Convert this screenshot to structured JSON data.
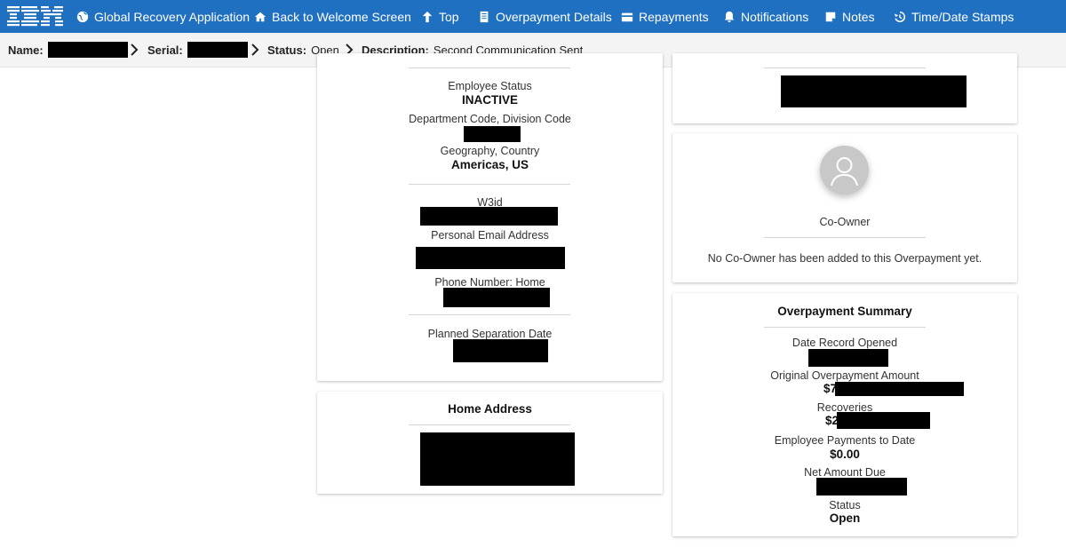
{
  "nav": {
    "logo_text": "IBM",
    "items": [
      {
        "label": "Global Recovery Application",
        "icon": "globe-icon"
      },
      {
        "label": "Back to Welcome Screen",
        "icon": "home-icon"
      },
      {
        "label": "Top",
        "icon": "arrow-up-icon"
      },
      {
        "label": "Overpayment Details",
        "icon": "document-icon"
      },
      {
        "label": "Repayments",
        "icon": "wallet-icon"
      },
      {
        "label": "Notifications",
        "icon": "bell-icon"
      },
      {
        "label": "Notes",
        "icon": "note-icon"
      },
      {
        "label": "Time/Date Stamps",
        "icon": "history-icon"
      }
    ],
    "color": "#1f70c1"
  },
  "breadcrumb": {
    "name_label": "Name:",
    "serial_label": "Serial:",
    "status_label": "Status:",
    "status_value": "Open",
    "description_label": "Description:",
    "description_value": "Second Communication Sent"
  },
  "employee_card": {
    "employee_status_label": "Employee Status",
    "employee_status_value": "INACTIVE",
    "department_label": "Department Code, Division Code",
    "geography_label": "Geography, Country",
    "geography_value": "Americas, US",
    "w3id_label": "W3id",
    "personal_email_label": "Personal Email Address",
    "phone_label": "Phone Number: Home",
    "planned_separation_label": "Planned Separation Date"
  },
  "home_address_card": {
    "title": "Home Address"
  },
  "coowner_card": {
    "label": "Co-Owner",
    "message": "No Co-Owner has been added to this Overpayment yet."
  },
  "summary_card": {
    "title": "Overpayment Summary",
    "date_opened_label": "Date Record Opened",
    "original_amount_label": "Original Overpayment Amount",
    "original_amount_prefix": "$7",
    "recoveries_label": "Recoveries",
    "recoveries_prefix": "$2",
    "employee_payments_label": "Employee Payments to Date",
    "employee_payments_value": "$0.00",
    "net_due_label": "Net Amount Due",
    "status_label": "Status",
    "status_value": "Open"
  }
}
